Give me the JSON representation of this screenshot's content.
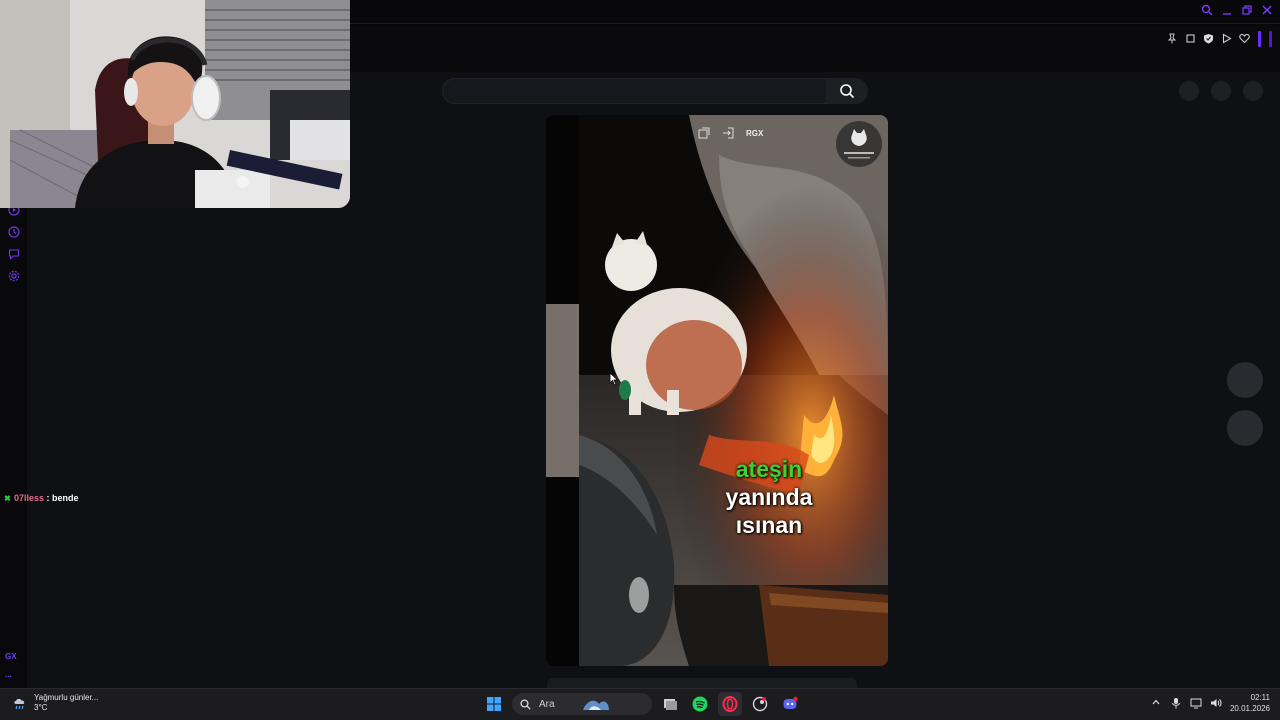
{
  "browser": {
    "window_controls": [
      "search-icon",
      "minimize-icon",
      "restore-icon",
      "close-icon"
    ],
    "extensions": [
      "pin-icon",
      "crop-icon",
      "shield-icon",
      "play-icon",
      "heart-icon"
    ],
    "accent_color": "#6a2cff"
  },
  "sidebar": {
    "icons": [
      "play-circle-icon",
      "history-icon",
      "chat-icon",
      "settings-icon"
    ],
    "bottom_label": "GX",
    "more_label": "..."
  },
  "page": {
    "search_placeholder": "",
    "top_right_buttons": 3
  },
  "video": {
    "watermark": "RGX",
    "caption_line1": "ateşin",
    "caption_line2": "yanında",
    "caption_line3": "ısınan"
  },
  "chat": {
    "username": "07lless",
    "separator": " : ",
    "message": "bende"
  },
  "taskbar": {
    "weather_title": "Yağmurlu günler...",
    "weather_temp": "3°C",
    "search_label": "Ara",
    "time": "02:11",
    "date": "20.01.2026"
  }
}
